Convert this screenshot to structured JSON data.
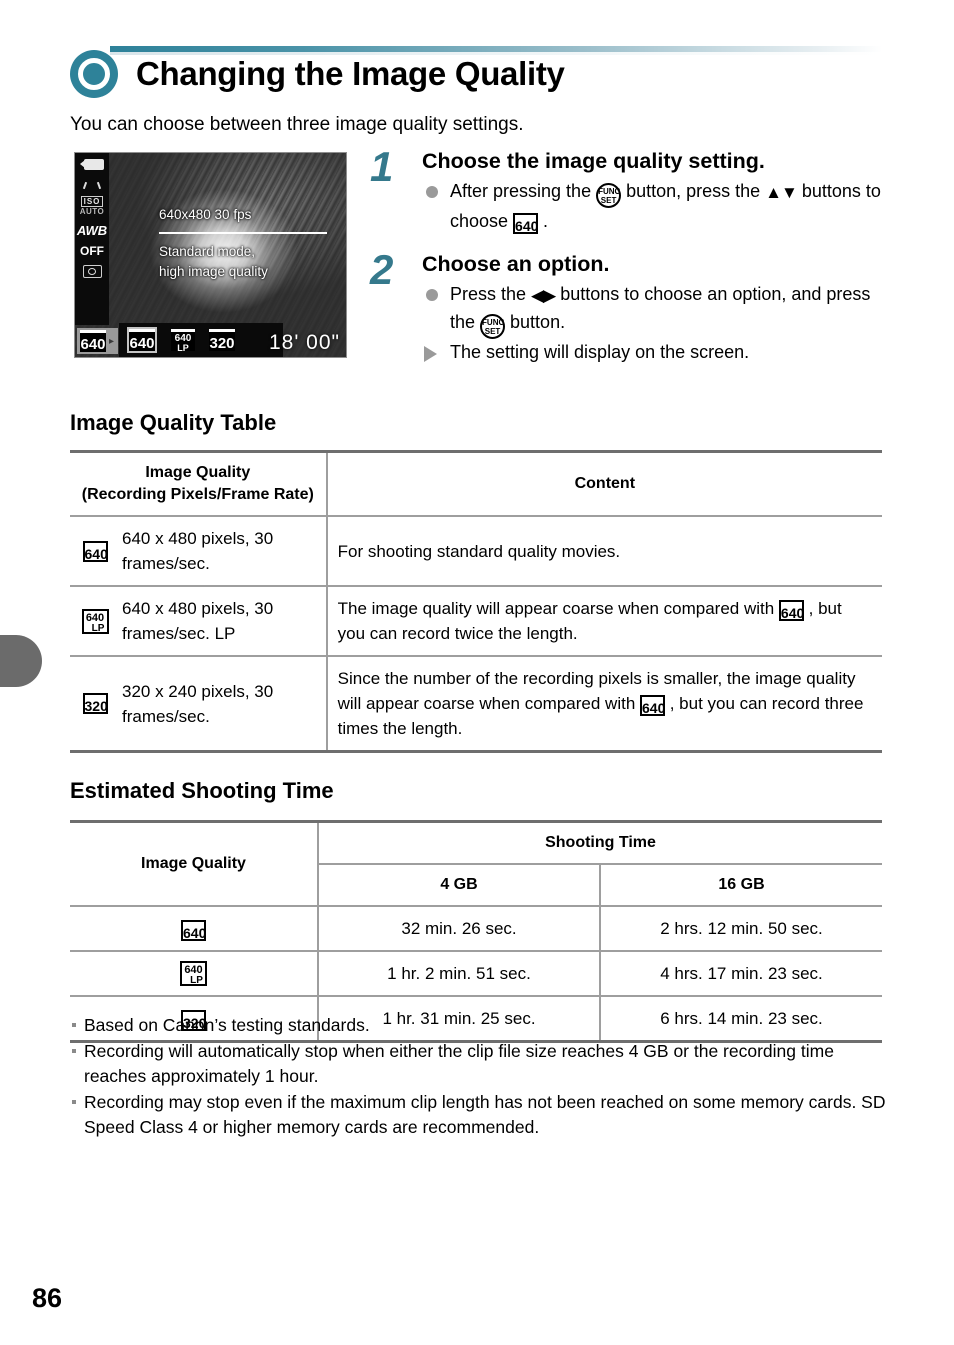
{
  "page": {
    "number": "86",
    "title": "Changing the Image Quality",
    "intro": "You can choose between three image quality settings.",
    "accent_color": "#2e8299",
    "step_number_color": "#35798c"
  },
  "screen_preview": {
    "name": "camera-lcd-preview",
    "overlay_line1": "640x480 30 fps",
    "overlay_line2": "Standard mode,",
    "overlay_line3": "high image quality",
    "remaining_time": "18' 00\"",
    "sidebar_icons": [
      "movie-mode-icon",
      "iso-auto-icon",
      "awb-icon",
      "flash-off-icon",
      "metering-icon"
    ],
    "iso_label": "ISO",
    "iso_value": "AUTO",
    "awb_label": "AWB",
    "flash_label": "OFF",
    "current_setting": "640",
    "options": [
      "640",
      "640 LP",
      "320"
    ],
    "selected_option_index": 0
  },
  "steps": [
    {
      "number": "1",
      "heading": "Choose the image quality setting.",
      "bullets": [
        {
          "type": "dot",
          "parts": [
            {
              "kind": "text",
              "text": "After pressing the "
            },
            {
              "kind": "icon",
              "icon": "func-set-button-icon",
              "l1": "FUNC",
              "l2": "SET"
            },
            {
              "kind": "text",
              "text": " button, press the "
            },
            {
              "kind": "icon",
              "icon": "up-down-arrows-icon",
              "text": "▲▼"
            },
            {
              "kind": "text",
              "text": " buttons to choose "
            },
            {
              "kind": "icon",
              "icon": "quality-640-icon",
              "text": "640"
            },
            {
              "kind": "text",
              "text": " ."
            }
          ]
        }
      ]
    },
    {
      "number": "2",
      "heading": "Choose an option.",
      "bullets": [
        {
          "type": "dot",
          "parts": [
            {
              "kind": "text",
              "text": "Press the "
            },
            {
              "kind": "icon",
              "icon": "left-right-arrows-icon",
              "text": "◀▶"
            },
            {
              "kind": "text",
              "text": " buttons to choose an option, and press the "
            },
            {
              "kind": "icon",
              "icon": "func-set-button-icon",
              "l1": "FUNC",
              "l2": "SET"
            },
            {
              "kind": "text",
              "text": " button."
            }
          ]
        },
        {
          "type": "triangle",
          "parts": [
            {
              "kind": "text",
              "text": "The setting will display on the screen."
            }
          ]
        }
      ]
    }
  ],
  "image_quality_table": {
    "heading": "Image Quality Table",
    "headers": {
      "col1_line1": "Image Quality",
      "col1_line2": "(Recording Pixels/Frame Rate)",
      "col2": "Content"
    },
    "rows": [
      {
        "icon": "quality-640-icon",
        "icon_label": "640",
        "spec": "640 x 480 pixels, 30 frames/sec.",
        "content": "For shooting standard quality movies."
      },
      {
        "icon": "quality-640-lp-icon",
        "icon_label": "640 LP",
        "spec": "640 x 480 pixels, 30 frames/sec. LP",
        "content": "The image quality will appear coarse when compared with [640] , but you can record twice the length.",
        "content_pre": "The image quality will appear coarse when compared with ",
        "content_post": " , but you can record twice the length."
      },
      {
        "icon": "quality-320-icon",
        "icon_label": "320",
        "spec": "320 x 240 pixels, 30 frames/sec.",
        "content": "Since the number of the recording pixels is smaller, the image quality will appear coarse when compared with [640] , but you can record three times the length.",
        "content_pre": "Since the number of the recording pixels is smaller, the image quality will appear coarse when compared with ",
        "content_post": " , but you can record three times the length."
      }
    ]
  },
  "shooting_time_table": {
    "heading": "Estimated Shooting Time",
    "headers": {
      "image_quality": "Image Quality",
      "shooting_time": "Shooting Time",
      "cap_4gb": "4 GB",
      "cap_16gb": "16 GB"
    },
    "rows": [
      {
        "icon": "quality-640-icon",
        "icon_label": "640",
        "t_4gb": "32 min. 26 sec.",
        "t_16gb": "2 hrs. 12 min. 50 sec."
      },
      {
        "icon": "quality-640-lp-icon",
        "icon_label": "640 LP",
        "t_4gb": "1 hr. 2 min. 51 sec.",
        "t_16gb": "4 hrs. 17 min. 23 sec."
      },
      {
        "icon": "quality-320-icon",
        "icon_label": "320",
        "t_4gb": "1 hr. 31 min. 25 sec.",
        "t_16gb": "6 hrs. 14 min. 23 sec."
      }
    ]
  },
  "notes": [
    "Based on Canon’s testing standards.",
    "Recording will automatically stop when either the clip file size reaches 4 GB or the recording time reaches approximately 1 hour.",
    "Recording may stop even if the maximum clip length has not been reached on some memory cards. SD Speed Class 4 or higher memory cards are recommended."
  ]
}
